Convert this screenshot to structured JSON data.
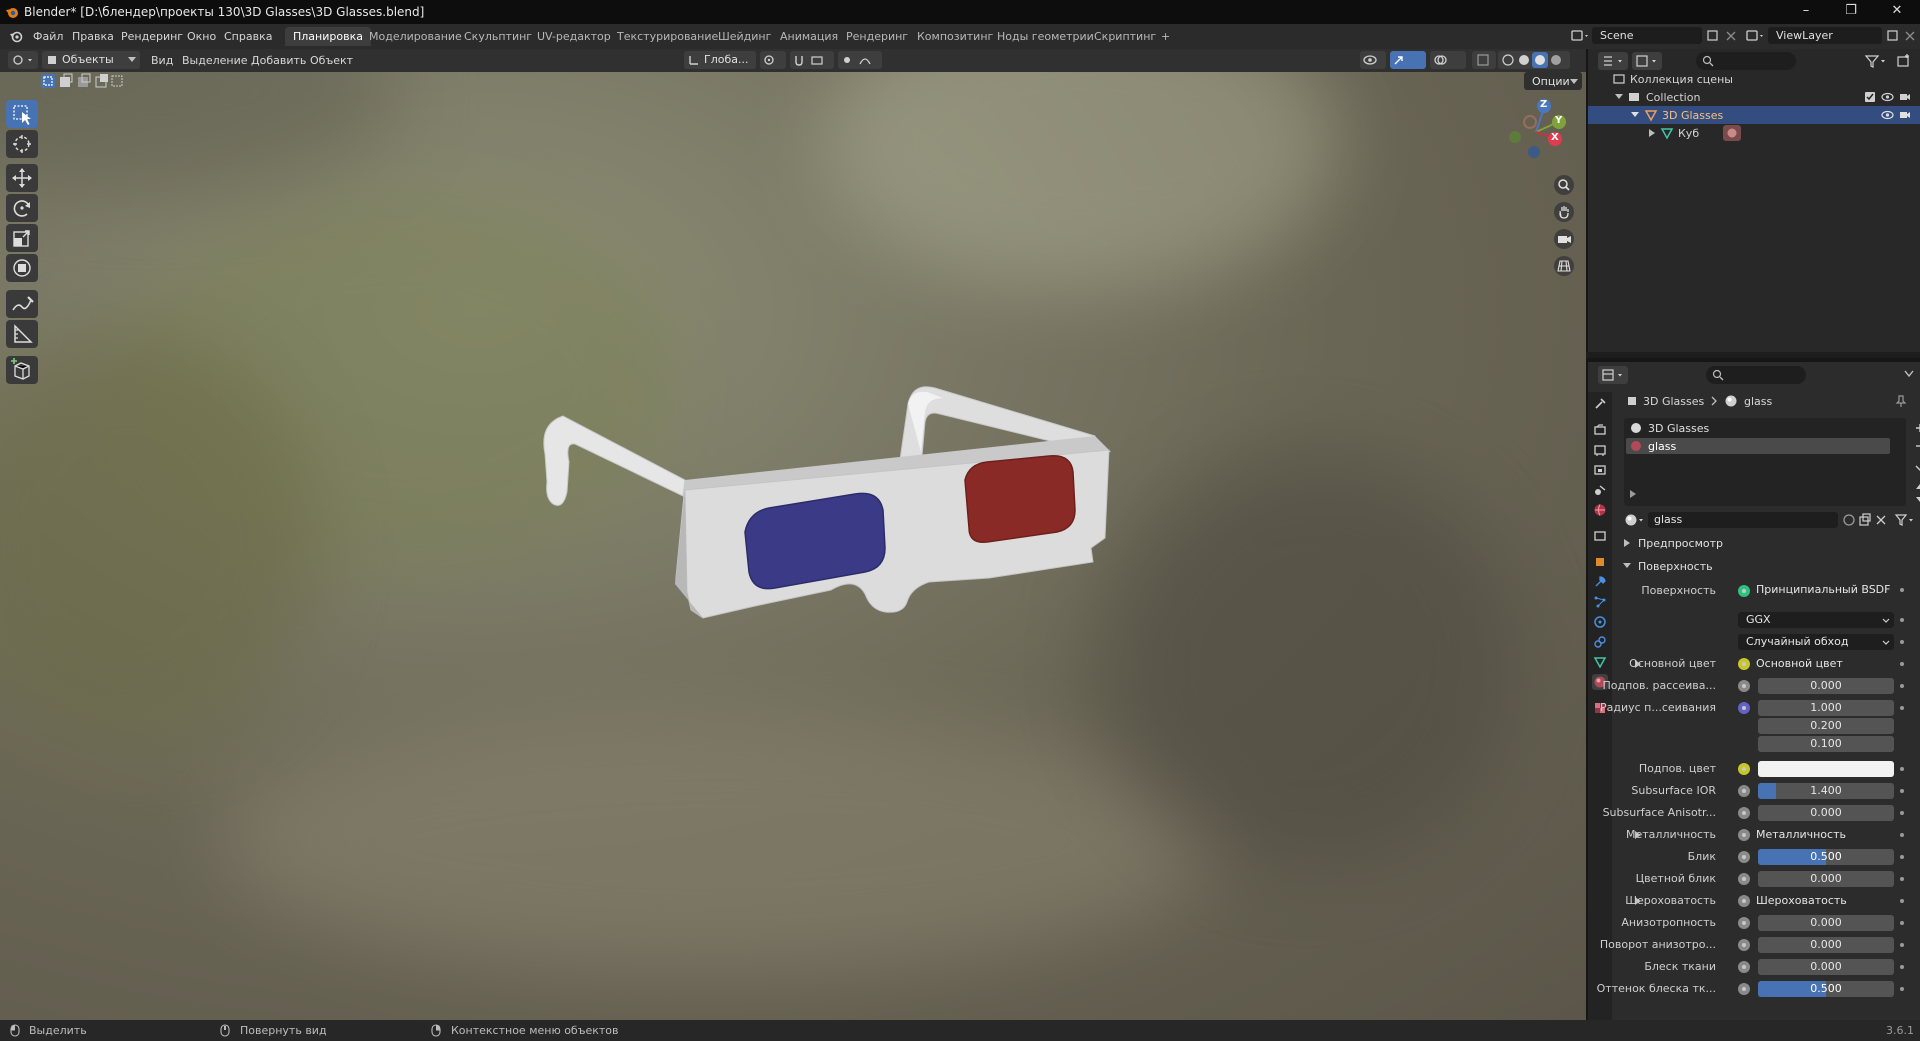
{
  "window": {
    "title": "Blender* [D:\\блендер\\проекты 130\\3D Glasses\\3D Glasses.blend]",
    "minimize_glyph": "–",
    "restore_glyph": "❐",
    "close_glyph": "✕"
  },
  "menu": {
    "file": "Файл",
    "edit": "Правка",
    "render": "Рендеринг",
    "window": "Окно",
    "help": "Справка"
  },
  "workspace_tabs": [
    "Планировка",
    "Моделирование",
    "Скульптинг",
    "UV-редактор",
    "Текстурирование",
    "Шейдинг",
    "Анимация",
    "Рендеринг",
    "Композитинг",
    "Ноды геометрии",
    "Скриптинг"
  ],
  "add_tab": "+",
  "scene": {
    "name": "Scene",
    "view_layer": "ViewLayer"
  },
  "viewport": {
    "mode": "Объекты",
    "menus": [
      "Вид",
      "Выделение",
      "Добавить",
      "Объект"
    ],
    "transform_orientation": "Глоба...",
    "options": "Опции",
    "gizmo": {
      "z": "Z",
      "y": "Y",
      "x": "X"
    }
  },
  "tools": [
    "select-box",
    "cursor",
    "move",
    "rotate",
    "scale",
    "transform",
    "annotate",
    "measure",
    "add-cube"
  ],
  "status_bar": {
    "select": "Выделить",
    "rotate_view": "Повернуть вид",
    "context_menu": "Контекстное меню объектов",
    "version": "3.6.1"
  },
  "outliner": {
    "root": "Коллекция сцены",
    "items": [
      {
        "name": "Collection",
        "level": 1
      },
      {
        "name": "3D Glasses",
        "level": 2,
        "selected": true
      },
      {
        "name": "Куб",
        "level": 3
      }
    ]
  },
  "properties": {
    "breadcrumb": {
      "object": "3D Glasses",
      "material": "glass"
    },
    "material_slots": [
      "3D Glasses",
      "glass"
    ],
    "material_name": "glass",
    "panels": {
      "preview": "Предпросмотр",
      "surface": "Поверхность"
    },
    "surface": {
      "surface_label": "Поверхность",
      "surface_value": "Принципиальный BSDF",
      "distribution": "GGX",
      "subsurface_method": "Случайный обход",
      "base_color_label": "Основной цвет",
      "base_color_value": "Основной цвет",
      "subsurface_label": "Подпов. рассеива...",
      "subsurface_value": "0.000",
      "radius_label": "Радиус п...сеивания",
      "radius": [
        "1.000",
        "0.200",
        "0.100"
      ],
      "subsurface_color_label": "Подпов. цвет",
      "subsurface_ior_label": "Subsurface IOR",
      "subsurface_ior_value": "1.400",
      "subsurface_aniso_label": "Subsurface Anisotr...",
      "subsurface_aniso_value": "0.000",
      "metallic_label": "Металличность",
      "metallic_value": "Металличность",
      "specular_label": "Блик",
      "specular_value": "0.500",
      "specular_fraction": 0.5,
      "specular_tint_label": "Цветной блик",
      "specular_tint_value": "0.000",
      "roughness_label": "Шероховатость",
      "roughness_value": "Шероховатость",
      "anisotropic_label": "Анизотропность",
      "anisotropic_value": "0.000",
      "aniso_rotation_label": "Поворот анизотро...",
      "aniso_rotation_value": "0.000",
      "sheen_label": "Блеск ткани",
      "sheen_value": "0.000",
      "sheen_tint_label": "Оттенок блеска тк...",
      "sheen_tint_value": "0.500",
      "sheen_tint_fraction": 0.5
    }
  },
  "colors": {
    "accent": "#4772b3",
    "lens_left": "#3a3a86",
    "lens_right": "#8a2a26",
    "frame": "#d8d8d8"
  }
}
